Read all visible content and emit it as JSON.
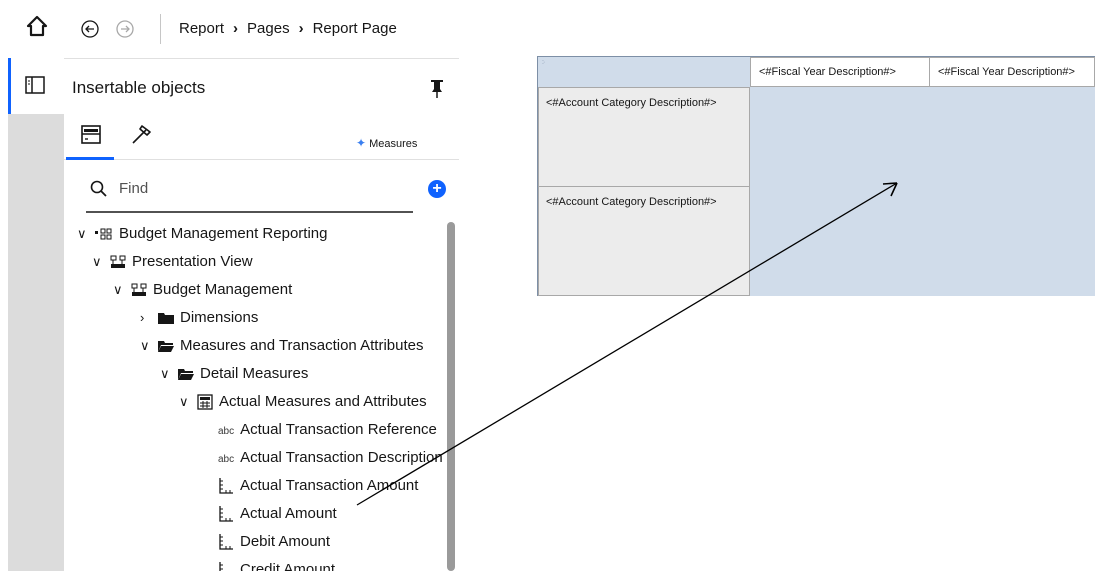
{
  "breadcrumb": {
    "items": [
      "Report",
      "Pages",
      "Report Page"
    ]
  },
  "panel": {
    "title": "Insertable objects"
  },
  "search": {
    "placeholder": "Find"
  },
  "tree": [
    {
      "label": "Budget Management Reporting",
      "icon": "package-icon",
      "expand": "expanded"
    },
    {
      "label": "Presentation View",
      "icon": "namespace-icon",
      "expand": "expanded"
    },
    {
      "label": "Budget Management",
      "icon": "namespace-icon",
      "expand": "expanded"
    },
    {
      "label": "Dimensions",
      "icon": "folder-icon",
      "expand": "collapsed"
    },
    {
      "label": "Measures and Transaction Attributes",
      "icon": "folder-open-icon",
      "expand": "expanded"
    },
    {
      "label": "Detail Measures",
      "icon": "folder-open-icon",
      "expand": "expanded"
    },
    {
      "label": "Actual Measures and Attributes",
      "icon": "query-subject-icon",
      "expand": "expanded"
    },
    {
      "label": "Actual Transaction Reference",
      "icon": "abc-icon",
      "expand": "none"
    },
    {
      "label": "Actual Transaction Description",
      "icon": "abc-icon",
      "expand": "none"
    },
    {
      "label": "Actual Transaction Amount",
      "icon": "measure-icon",
      "expand": "none"
    },
    {
      "label": "Actual Amount",
      "icon": "measure-icon",
      "expand": "none"
    },
    {
      "label": "Debit Amount",
      "icon": "measure-icon",
      "expand": "none"
    },
    {
      "label": "Credit Amount",
      "icon": "measure-icon",
      "expand": "none"
    }
  ],
  "crosstab": {
    "col_headers": [
      "<#Fiscal Year Description#>",
      "<#Fiscal Year Description#>"
    ],
    "row_headers": [
      "<#Account Category Description#>",
      "<#Account Category Description#>"
    ],
    "measure_label": "Measures"
  },
  "colors": {
    "accent": "#0f62fe",
    "crosstab_fill": "#d0dcea",
    "rail": "#dcdcdc"
  }
}
